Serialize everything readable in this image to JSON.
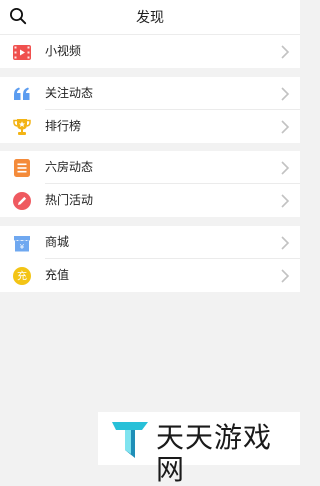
{
  "header": {
    "title": "发现",
    "search_icon": "search-icon"
  },
  "groups": [
    {
      "items": [
        {
          "label": "小视频",
          "icon": "video-icon",
          "color": "#f0504e"
        }
      ]
    },
    {
      "items": [
        {
          "label": "关注动态",
          "icon": "quote-icon",
          "color": "#5b9cf0"
        },
        {
          "label": "排行榜",
          "icon": "trophy-icon",
          "color": "#f3b415"
        }
      ]
    },
    {
      "items": [
        {
          "label": "六房动态",
          "icon": "list-icon",
          "color": "#f48b3a"
        },
        {
          "label": "热门活动",
          "icon": "pencil-icon",
          "color": "#ef5a60"
        }
      ]
    },
    {
      "items": [
        {
          "label": "商城",
          "icon": "shop-icon",
          "color": "#6fa8f0"
        },
        {
          "label": "充值",
          "icon": "recharge-icon",
          "color": "#f3c415"
        }
      ]
    }
  ],
  "watermark": {
    "text": "天天游戏网"
  }
}
